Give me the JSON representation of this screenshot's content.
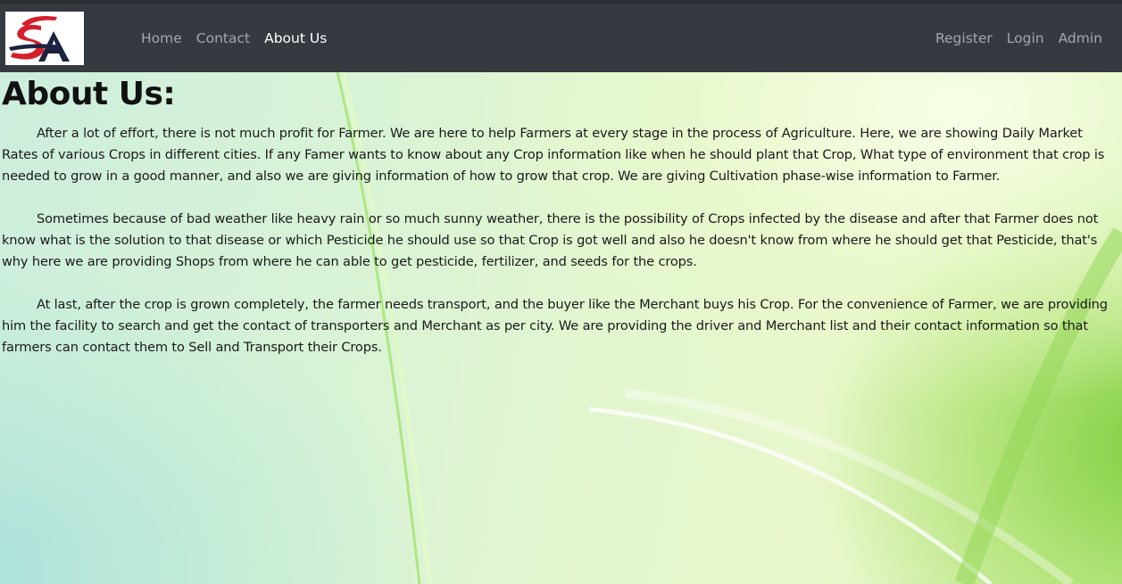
{
  "navbar": {
    "logo_text": "SA",
    "left_links": [
      {
        "label": "Home",
        "active": false
      },
      {
        "label": "Contact",
        "active": false
      },
      {
        "label": "About Us",
        "active": true
      }
    ],
    "right_links": [
      {
        "label": "Register"
      },
      {
        "label": "Login"
      },
      {
        "label": "Admin"
      }
    ]
  },
  "main": {
    "title": "About Us:",
    "paragraphs": [
      "After a lot of effort, there is not much profit for Farmer. We are here to help Farmers at every stage in the process of Agriculture. Here, we are showing Daily Market Rates of various Crops in different cities. If any Famer wants to know about any Crop information like when he should plant that Crop, What type of environment that crop is needed to grow in a good manner, and also we are giving information of how to grow that crop. We are giving Cultivation phase-wise information to Farmer.",
      "Sometimes because of bad weather like heavy rain or so much sunny weather, there is the possibility of Crops infected by the disease and after that Farmer does not know what is the solution to that disease or which Pesticide he should use so that Crop is got well and also he doesn't know from where he should get that Pesticide, that's why here we are providing Shops from where he can able to get pesticide, fertilizer, and seeds for the crops.",
      "At last, after the crop is grown completely, the farmer needs transport, and the buyer like the Merchant buys his Crop. For the convenience of Farmer, we are providing him the facility to search and get the contact of transporters and Merchant as per city. We are providing the driver and Merchant list and their contact information so that farmers can contact them to Sell and Transport their Crops."
    ]
  },
  "colors": {
    "navbar_bg": "#343a40",
    "nav_link": "rgba(255,255,255,0.55)",
    "nav_link_active": "#ffffff",
    "logo_red": "#d4202a",
    "logo_navy": "#1c2340"
  }
}
